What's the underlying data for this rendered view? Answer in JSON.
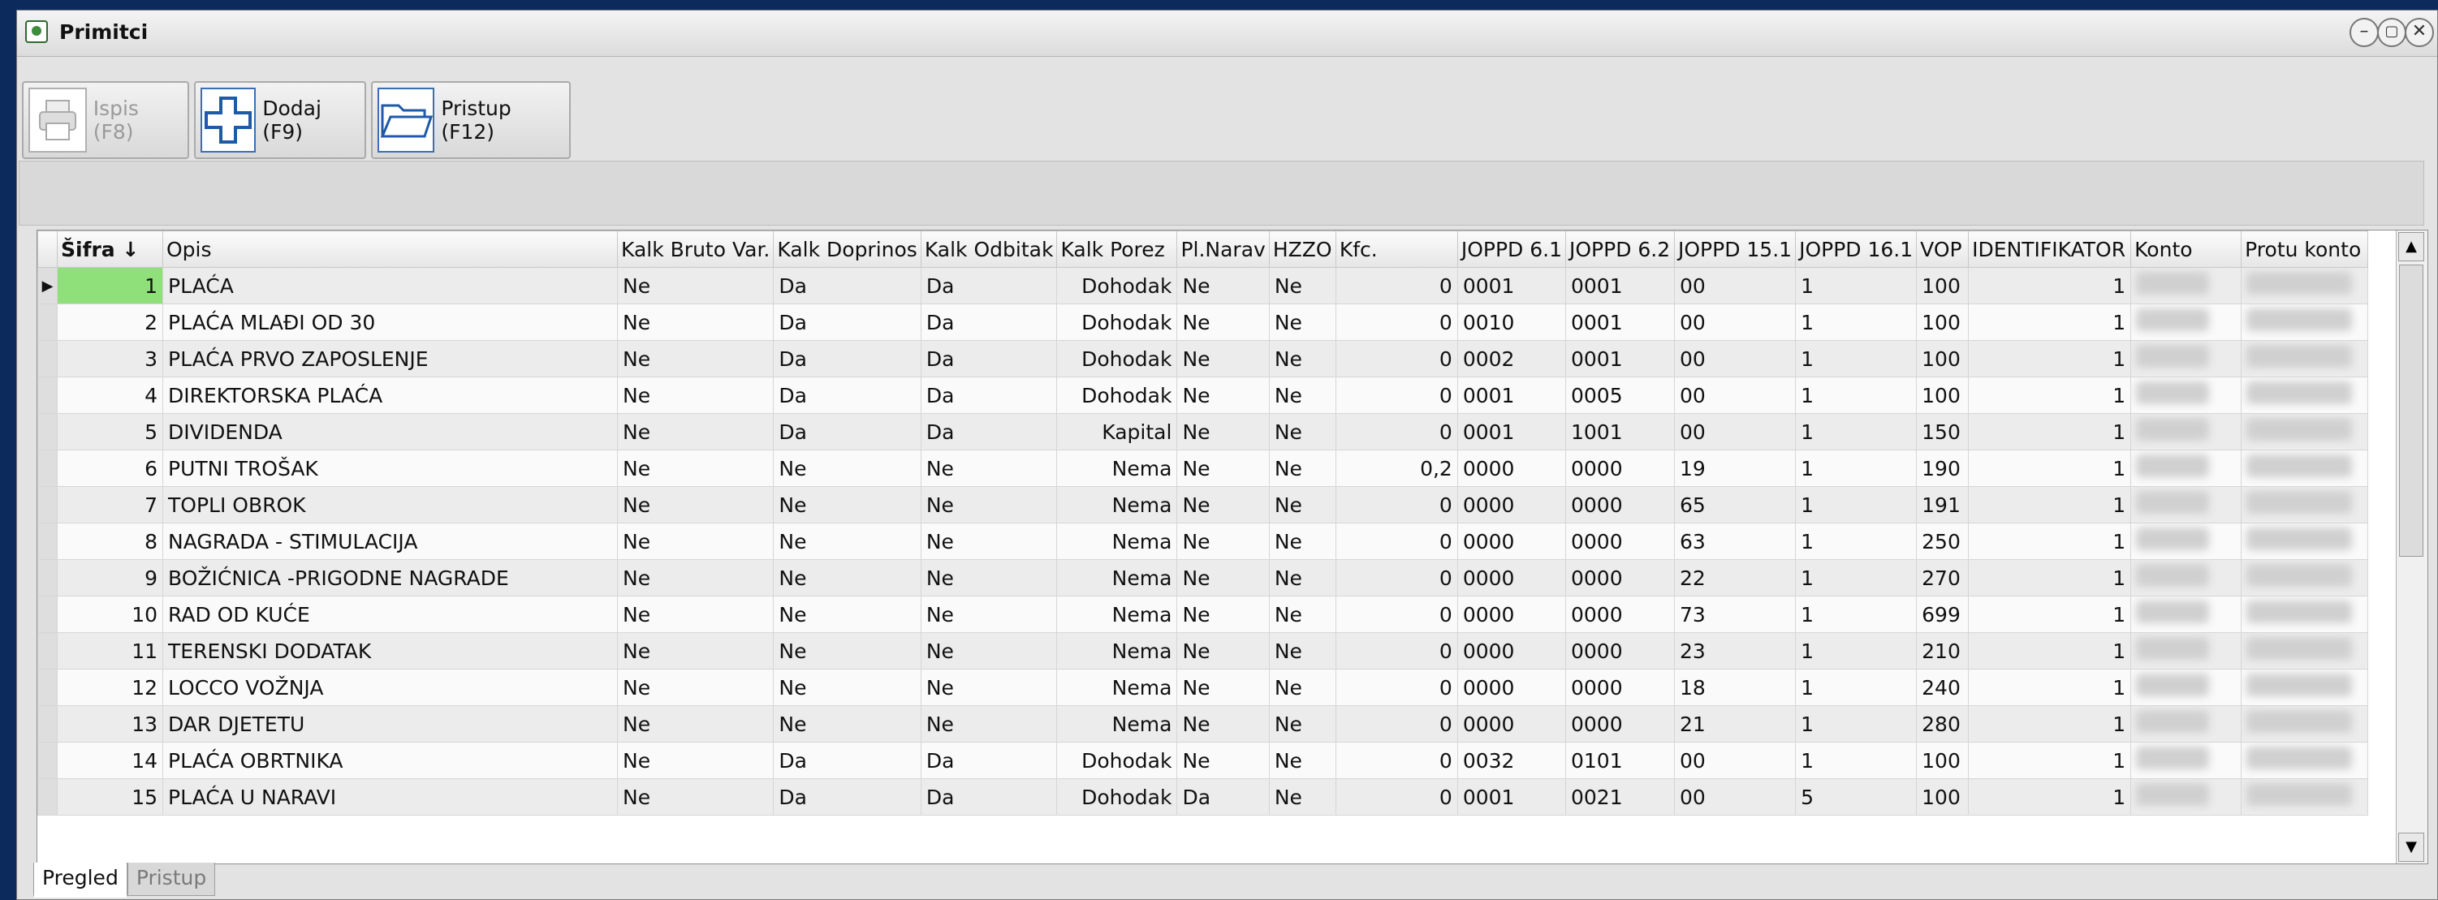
{
  "window": {
    "title": "Primitci"
  },
  "toolbar": {
    "buttons": [
      {
        "label": "Ispis (F8)",
        "icon": "printer-icon",
        "disabled": true
      },
      {
        "label": "Dodaj (F9)",
        "icon": "plus-icon",
        "disabled": false
      },
      {
        "label": "Pristup (F12)",
        "icon": "folder-icon",
        "disabled": false
      }
    ]
  },
  "table": {
    "columns": [
      "Šifra ↓",
      "Opis",
      "Kalk Bruto Var.",
      "Kalk Doprinos",
      "Kalk Odbitak",
      "Kalk Porez",
      "Pl.Narav",
      "HZZO",
      "Kfc.",
      "JOPPD 6.1",
      "JOPPD 6.2",
      "JOPPD 15.1",
      "JOPPD 16.1",
      "VOP",
      "IDENTIFIKATOR",
      "Konto",
      "Protu konto"
    ],
    "rows": [
      [
        "1",
        "PLAĆA",
        "Ne",
        "Da",
        "Da",
        "Dohodak",
        "Ne",
        "Ne",
        "0",
        "0001",
        "0001",
        "00",
        "1",
        "100",
        "1",
        "",
        ""
      ],
      [
        "2",
        "PLAĆA MLAĐI OD 30",
        "Ne",
        "Da",
        "Da",
        "Dohodak",
        "Ne",
        "Ne",
        "0",
        "0010",
        "0001",
        "00",
        "1",
        "100",
        "1",
        "",
        ""
      ],
      [
        "3",
        "PLAĆA PRVO ZAPOSLENJE",
        "Ne",
        "Da",
        "Da",
        "Dohodak",
        "Ne",
        "Ne",
        "0",
        "0002",
        "0001",
        "00",
        "1",
        "100",
        "1",
        "",
        ""
      ],
      [
        "4",
        "DIREKTORSKA PLAĆA",
        "Ne",
        "Da",
        "Da",
        "Dohodak",
        "Ne",
        "Ne",
        "0",
        "0001",
        "0005",
        "00",
        "1",
        "100",
        "1",
        "",
        ""
      ],
      [
        "5",
        "DIVIDENDA",
        "Ne",
        "Da",
        "Da",
        "Kapital",
        "Ne",
        "Ne",
        "0",
        "0001",
        "1001",
        "00",
        "1",
        "150",
        "1",
        "",
        ""
      ],
      [
        "6",
        "PUTNI TROŠAK",
        "Ne",
        "Ne",
        "Ne",
        "Nema",
        "Ne",
        "Ne",
        "0,2",
        "0000",
        "0000",
        "19",
        "1",
        "190",
        "1",
        "",
        ""
      ],
      [
        "7",
        "TOPLI OBROK",
        "Ne",
        "Ne",
        "Ne",
        "Nema",
        "Ne",
        "Ne",
        "0",
        "0000",
        "0000",
        "65",
        "1",
        "191",
        "1",
        "",
        ""
      ],
      [
        "8",
        "NAGRADA - STIMULACIJA",
        "Ne",
        "Ne",
        "Ne",
        "Nema",
        "Ne",
        "Ne",
        "0",
        "0000",
        "0000",
        "63",
        "1",
        "250",
        "1",
        "",
        ""
      ],
      [
        "9",
        "BOŽIĆNICA -PRIGODNE NAGRADE",
        "Ne",
        "Ne",
        "Ne",
        "Nema",
        "Ne",
        "Ne",
        "0",
        "0000",
        "0000",
        "22",
        "1",
        "270",
        "1",
        "",
        ""
      ],
      [
        "10",
        "RAD OD KUĆE",
        "Ne",
        "Ne",
        "Ne",
        "Nema",
        "Ne",
        "Ne",
        "0",
        "0000",
        "0000",
        "73",
        "1",
        "699",
        "1",
        "",
        ""
      ],
      [
        "11",
        "TERENSKI DODATAK",
        "Ne",
        "Ne",
        "Ne",
        "Nema",
        "Ne",
        "Ne",
        "0",
        "0000",
        "0000",
        "23",
        "1",
        "210",
        "1",
        "",
        ""
      ],
      [
        "12",
        "LOCCO VOŽNJA",
        "Ne",
        "Ne",
        "Ne",
        "Nema",
        "Ne",
        "Ne",
        "0",
        "0000",
        "0000",
        "18",
        "1",
        "240",
        "1",
        "",
        ""
      ],
      [
        "13",
        "DAR DJETETU",
        "Ne",
        "Ne",
        "Ne",
        "Nema",
        "Ne",
        "Ne",
        "0",
        "0000",
        "0000",
        "21",
        "1",
        "280",
        "1",
        "",
        ""
      ],
      [
        "14",
        "PLAĆA OBRTNIKA",
        "Ne",
        "Da",
        "Da",
        "Dohodak",
        "Ne",
        "Ne",
        "0",
        "0032",
        "0101",
        "00",
        "1",
        "100",
        "1",
        "",
        ""
      ],
      [
        "15",
        "PLAĆA U NARAVI",
        "Ne",
        "Da",
        "Da",
        "Dohodak",
        "Da",
        "Ne",
        "0",
        "0001",
        "0021",
        "00",
        "5",
        "100",
        "1",
        "",
        ""
      ]
    ]
  },
  "tabs": [
    {
      "label": "Pregled",
      "active": true
    },
    {
      "label": "Pristup",
      "active": false
    }
  ]
}
